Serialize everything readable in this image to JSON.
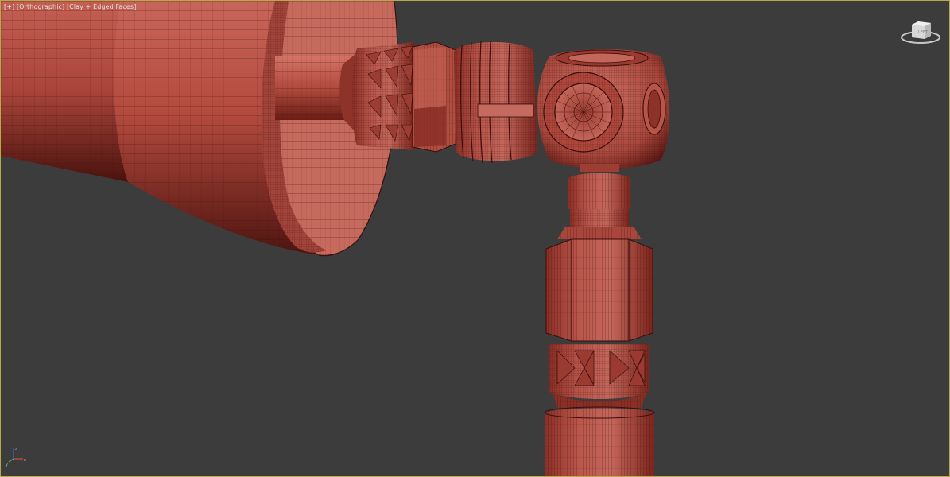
{
  "viewport": {
    "menu_label": "[+]",
    "view_label": "[Orthographic]",
    "shading_label": "[Clay + Edged Faces]"
  },
  "viewcube": {
    "icon": "viewcube-icon",
    "face_label": "LEFT"
  },
  "axis_tripod": {
    "icon": "axis-tripod-icon",
    "x_label": "x",
    "y_label": "y",
    "z_label": "z"
  },
  "colors": {
    "background": "#3c3c3c",
    "active_border": "#b8a94a",
    "clay": "#b34a3e",
    "clay_dark": "#5e1a15",
    "clay_light": "#cf6e60",
    "wire": "#3a0e0b"
  }
}
